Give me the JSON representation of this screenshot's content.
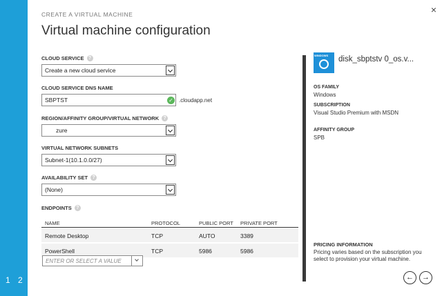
{
  "wizard": {
    "kicker": "CREATE A VIRTUAL MACHINE",
    "title": "Virtual machine configuration",
    "steps": [
      "1",
      "2"
    ],
    "close_glyph": "×"
  },
  "form": {
    "cloud_service": {
      "label": "CLOUD SERVICE",
      "value": "Create a new cloud service"
    },
    "dns_name": {
      "label": "CLOUD SERVICE DNS NAME",
      "value": "SBPTST",
      "suffix": ".cloudapp.net"
    },
    "region": {
      "label": "REGION/AFFINITY GROUP/VIRTUAL NETWORK",
      "value": "zure"
    },
    "subnets": {
      "label": "VIRTUAL NETWORK SUBNETS",
      "value": "Subnet-1(10.1.0.0/27)"
    },
    "availability_set": {
      "label": "AVAILABILITY SET",
      "value": "(None)"
    }
  },
  "endpoints": {
    "label": "ENDPOINTS",
    "columns": [
      "NAME",
      "PROTOCOL",
      "PUBLIC PORT",
      "PRIVATE PORT"
    ],
    "rows": [
      {
        "name": "Remote Desktop",
        "protocol": "TCP",
        "public_port": "AUTO",
        "private_port": "3389"
      },
      {
        "name": "PowerShell",
        "protocol": "TCP",
        "public_port": "5986",
        "private_port": "5986"
      }
    ],
    "combo_placeholder": "ENTER OR SELECT A VALUE"
  },
  "summary": {
    "disk_name": "disk_sbptstv            0_os.v...",
    "icon_label": "WINDOWS",
    "os_family_label": "OS FAMILY",
    "os_family": "Windows",
    "subscription_label": "SUBSCRIPTION",
    "subscription": "Visual Studio Premium with MSDN",
    "affinity_label": "AFFINITY GROUP",
    "affinity": "SPB"
  },
  "pricing": {
    "label": "PRICING INFORMATION",
    "text": "Pricing varies based on the subscription you select to provision your virtual machine."
  },
  "nav": {
    "prev_glyph": "←",
    "next_glyph": "→"
  },
  "colors": {
    "rail": "#1e9fd8",
    "ok": "#5cb85c",
    "disk_tile": "#1e90d8"
  }
}
